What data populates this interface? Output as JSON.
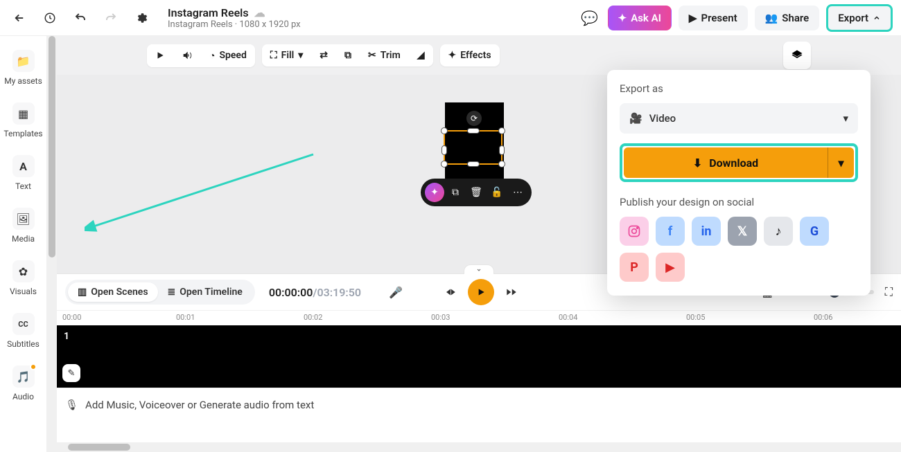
{
  "topbar": {
    "title": "Instagram Reels",
    "subtitle": "Instagram Reels · 1080 x 1920 px",
    "ask_ai": "Ask AI",
    "present": "Present",
    "share": "Share",
    "export": "Export"
  },
  "rail": {
    "my_assets": "My assets",
    "templates": "Templates",
    "text": "Text",
    "media": "Media",
    "visuals": "Visuals",
    "subtitles": "Subtitles",
    "audio": "Audio"
  },
  "toolbar2": {
    "speed": "Speed",
    "fill": "Fill",
    "trim": "Trim",
    "effects": "Effects"
  },
  "export_panel": {
    "title": "Export as",
    "type": "Video",
    "download": "Download",
    "publish_title": "Publish your design on social"
  },
  "timeline": {
    "open_scenes": "Open Scenes",
    "open_timeline": "Open Timeline",
    "current": "00:00:00",
    "duration": "/03:19:50",
    "track_number": "1",
    "add_audio": "Add Music, Voiceover or Generate audio from text",
    "ruler": [
      "00:00",
      "00:01",
      "00:02",
      "00:03",
      "00:04",
      "00:05",
      "00:06"
    ]
  }
}
